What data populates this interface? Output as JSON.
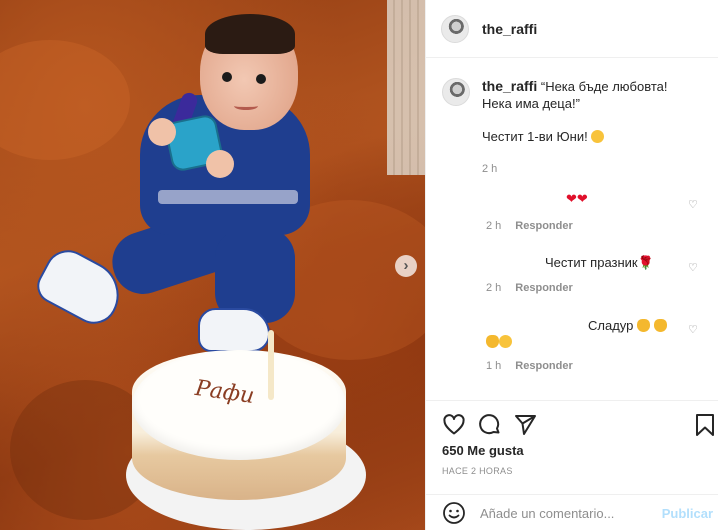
{
  "post": {
    "author": "the_raffi",
    "cake_writing": "Рафи",
    "next_arrow": "›"
  },
  "caption": {
    "username": "the_raffi",
    "line1": "“Нека бъде любовта!",
    "line2": "Нека има деца!”",
    "greeting": "Честит 1-ви Юни!",
    "time": "2 h"
  },
  "comments": [
    {
      "text": "❤❤",
      "time": "2 h",
      "reply": "Responder"
    },
    {
      "text": "Честит празник",
      "time": "2 h",
      "reply": "Responder"
    },
    {
      "text": "Сладур",
      "time": "1 h",
      "reply": "Responder"
    }
  ],
  "actions": {
    "likes": "650 Me gusta",
    "timestamp": "HACE 2 HORAS",
    "comment_placeholder": "Añade un comentario...",
    "publish_label": "Publicar"
  },
  "icons": [
    "heart-icon",
    "comment-icon",
    "share-icon",
    "bookmark-icon",
    "emoji-icon",
    "chevron-right-icon"
  ],
  "colors": {
    "accent": "#b2dffc",
    "secondary_text": "#8e8e8e",
    "divider": "#efefef"
  }
}
